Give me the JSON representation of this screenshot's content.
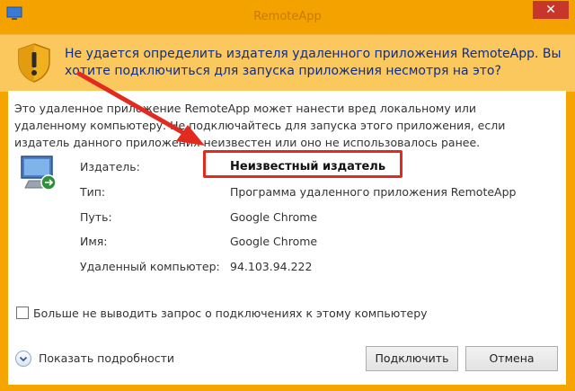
{
  "window": {
    "title": "RemoteApp",
    "close_glyph": "✕"
  },
  "warning": {
    "icon": "shield-warning-icon",
    "text": "Не удается определить издателя удаленного приложения RemoteApp. Вы хотите подключиться для запуска приложения несмотря на это?"
  },
  "description": "Это удаленное приложение RemoteApp может нанести вред локальному или удаленному компьютеру. Не подключайтесь для запуска этого приложения, если издатель данного приложения неизвестен или оно не использовалось ранее.",
  "details": {
    "icon": "remote-computer-icon",
    "rows": [
      {
        "label": "Издатель:",
        "value": "Неизвестный издатель"
      },
      {
        "label": "Тип:",
        "value": "Программа удаленного приложения RemoteApp"
      },
      {
        "label": "Путь:",
        "value": "Google Chrome"
      },
      {
        "label": "Имя:",
        "value": "Google Chrome"
      },
      {
        "label": "Удаленный компьютер:",
        "value": "94.103.94.222"
      }
    ]
  },
  "checkbox": {
    "label": "Больше не выводить запрос о подключениях к этому компьютеру",
    "checked": false
  },
  "show_details": {
    "label": "Показать подробности",
    "icon": "chevron-down-icon"
  },
  "buttons": {
    "connect": "Подключить",
    "cancel": "Отмена"
  },
  "colors": {
    "titlebar": "#f3a200",
    "warning_band": "#fbc85e",
    "warning_text": "#0d2d8c",
    "highlight": "#e22a1f"
  }
}
